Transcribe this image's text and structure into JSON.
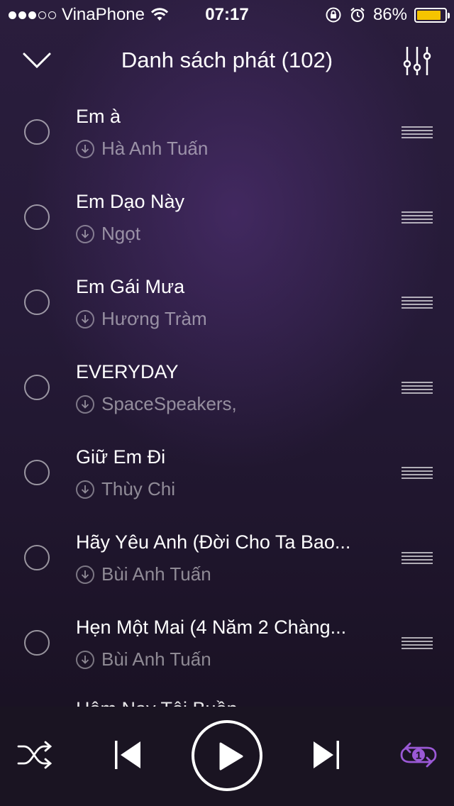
{
  "status_bar": {
    "carrier": "VinaPhone",
    "time": "07:17",
    "battery_percent": "86%",
    "battery_level": 0.86,
    "battery_color": "#f5c400"
  },
  "header": {
    "title": "Danh sách phát (102)",
    "collapse_icon": "chevron-down-icon",
    "equalizer_icon": "equalizer-icon"
  },
  "playlist": [
    {
      "title": "Em à",
      "artist": "Hà Anh Tuấn"
    },
    {
      "title": "Em Dạo Này",
      "artist": "Ngọt"
    },
    {
      "title": "Em Gái Mưa",
      "artist": "Hương Tràm"
    },
    {
      "title": "EVERYDAY",
      "artist": "SpaceSpeakers,"
    },
    {
      "title": "Giữ Em Đi",
      "artist": "Thùy Chi"
    },
    {
      "title": "Hãy Yêu Anh (Đời Cho Ta Bao...",
      "artist": "Bùi Anh Tuấn"
    },
    {
      "title": "Hẹn Một Mai (4 Năm 2 Chàng...",
      "artist": "Bùi Anh Tuấn"
    }
  ],
  "partial_row_title": "Hôm Nay Tôi Buồn",
  "player": {
    "repeat_badge": "1",
    "accent_color": "#9b59d6"
  }
}
